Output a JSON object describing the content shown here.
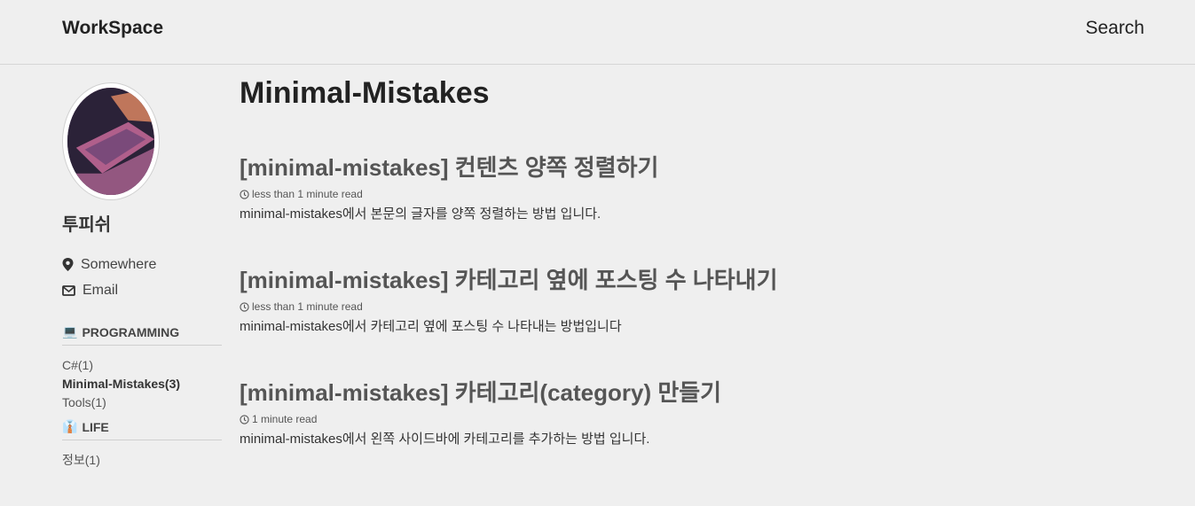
{
  "header": {
    "site_title": "WorkSpace",
    "search_label": "Search"
  },
  "author": {
    "name": "투피쉬",
    "location": "Somewhere",
    "email_label": "Email"
  },
  "categories": [
    {
      "emoji": "💻",
      "title": "PROGRAMMING",
      "items": [
        "C#(1)",
        "Minimal-Mistakes(3)",
        "Tools(1)"
      ]
    },
    {
      "emoji": "👔",
      "title": "LIFE",
      "items": [
        "정보(1)"
      ]
    }
  ],
  "main": {
    "page_title": "Minimal-Mistakes",
    "posts": [
      {
        "title": "[minimal-mistakes] 컨텐츠 양쪽 정렬하기",
        "read_time": "less than 1 minute read",
        "excerpt": "minimal-mistakes에서 본문의 글자를 양쪽 정렬하는 방법 입니다."
      },
      {
        "title": "[minimal-mistakes] 카테고리 옆에 포스팅 수 나타내기",
        "read_time": "less than 1 minute read",
        "excerpt": "minimal-mistakes에서 카테고리 옆에 포스팅 수 나타내는 방법입니다"
      },
      {
        "title": "[minimal-mistakes] 카테고리(category) 만들기",
        "read_time": "1 minute read",
        "excerpt": "minimal-mistakes에서 왼쪽 사이드바에 카테고리를 추가하는 방법 입니다."
      }
    ]
  }
}
